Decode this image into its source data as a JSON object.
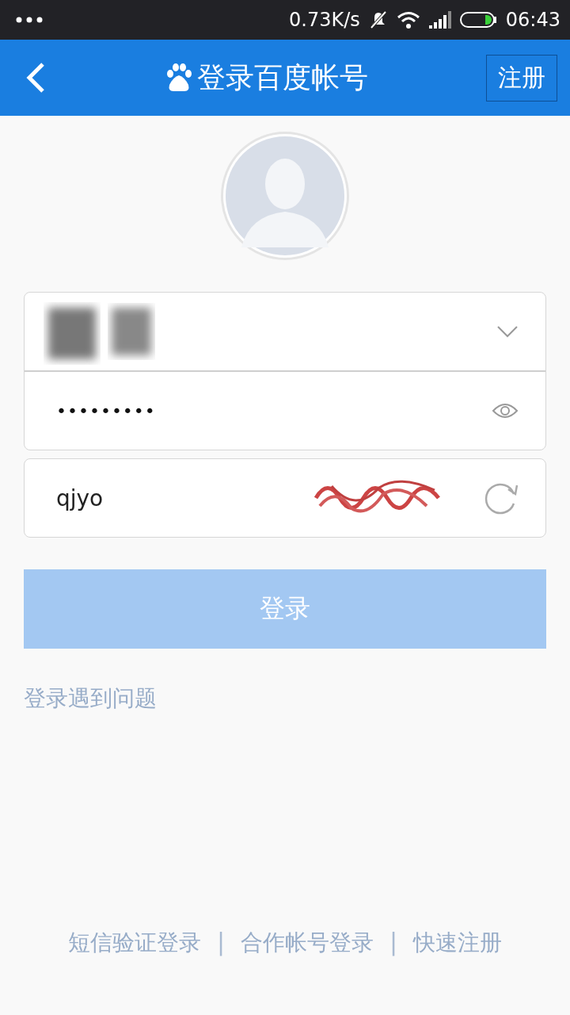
{
  "status_bar": {
    "speed": "0.73K/s",
    "time": "06:43"
  },
  "header": {
    "title": "登录百度帐号",
    "action": "注册"
  },
  "form": {
    "password": {
      "value": "•••••••••"
    },
    "captcha": {
      "value": "qjyo"
    },
    "login_button": {
      "label": "登录",
      "disabled": true
    },
    "help_link": "登录遇到问题"
  },
  "footer": [
    {
      "kind": "link",
      "text": "短信验证登录"
    },
    {
      "kind": "separator",
      "text": "|"
    },
    {
      "kind": "link",
      "text": "合作帐号登录"
    },
    {
      "kind": "separator",
      "text": "|"
    },
    {
      "kind": "link",
      "text": "快速注册"
    }
  ]
}
